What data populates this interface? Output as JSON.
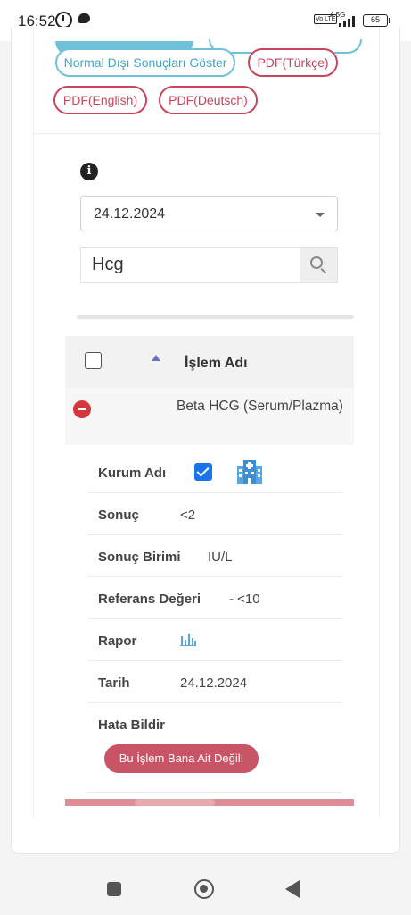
{
  "status_bar": {
    "time": "16:52",
    "network": "4.5G",
    "volte": "Vo LTE",
    "battery": "65"
  },
  "actions": {
    "show_abnormal": "Normal Dışı Sonuçları Göster",
    "pdf_tr": "PDF(Türkçe)",
    "pdf_en": "PDF(English)",
    "pdf_de": "PDF(Deutsch)"
  },
  "filters": {
    "date_value": "24.12.2024",
    "search_value": "Hcg"
  },
  "table": {
    "header": "İşlem Adı",
    "row": {
      "name": "Beta HCG (Serum/Plazma)",
      "details": {
        "institution_label": "Kurum Adı",
        "result_label": "Sonuç",
        "result_value": "<2",
        "unit_label": "Sonuç Birimi",
        "unit_value": "IU/L",
        "reference_label": "Referans Değeri",
        "reference_value": "- <10",
        "report_label": "Rapor",
        "date_label": "Tarih",
        "date_value": "24.12.2024",
        "report_error_label": "Hata Bildir",
        "not_mine_button": "Bu İşlem Bana Ait Değil!"
      }
    }
  },
  "colors": {
    "blue_pill": "#6ec1d9",
    "red_pill": "#c8455d",
    "checkbox_checked": "#1a73e8",
    "collapse_icon": "#d6373c",
    "error_button": "#c85466"
  }
}
